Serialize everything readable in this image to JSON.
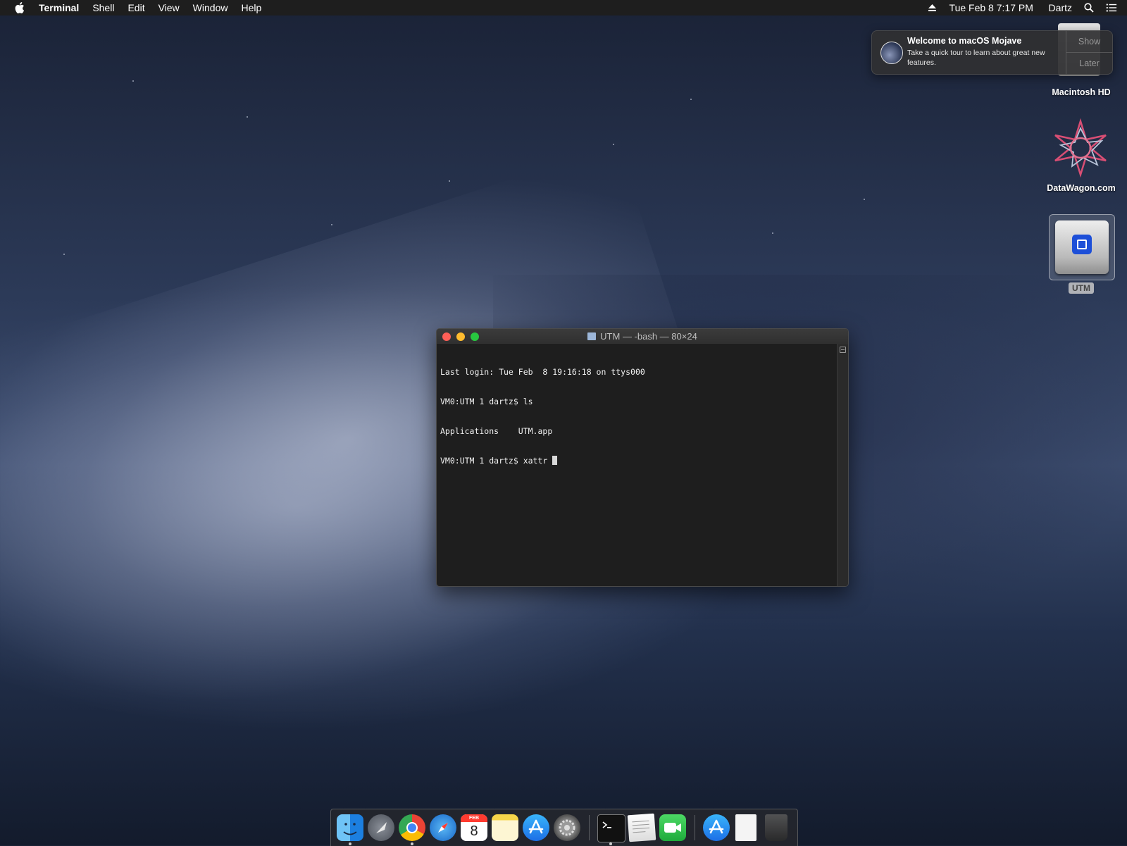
{
  "menubar": {
    "apple_icon": "apple-icon",
    "app_name": "Terminal",
    "menus": [
      "Shell",
      "Edit",
      "View",
      "Window",
      "Help"
    ],
    "status": {
      "eject_icon": "eject-icon",
      "datetime": "Tue Feb 8  7:17 PM",
      "user": "Dartz",
      "spotlight_icon": "search-icon",
      "notification_center_icon": "list-icon"
    }
  },
  "notification": {
    "title": "Welcome to macOS Mojave",
    "body": "Take a quick tour to learn about great new features.",
    "show_label": "Show",
    "later_label": "Later"
  },
  "desktop_icons": {
    "macintosh_hd": "Macintosh HD",
    "datawagon": "DataWagon.com",
    "utm": "UTM"
  },
  "terminal": {
    "title": "UTM — -bash — 80×24",
    "lines": [
      "Last login: Tue Feb  8 19:16:18 on ttys000",
      "VM0:UTM 1 dartz$ ls",
      "Applications    UTM.app",
      "VM0:UTM 1 dartz$ xattr "
    ]
  },
  "dock": {
    "apps": [
      "Finder",
      "Launchpad",
      "Google Chrome",
      "Safari",
      "Calendar",
      "Notes",
      "App Store",
      "System Preferences",
      "Terminal",
      "TextEdit",
      "FaceTime",
      "Applications",
      "Document",
      "Trash"
    ],
    "calendar_month": "FEB",
    "calendar_day": "8"
  }
}
